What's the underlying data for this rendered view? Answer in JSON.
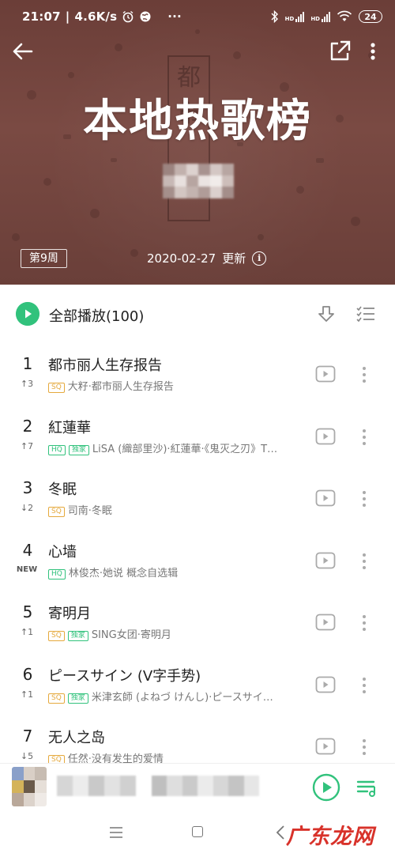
{
  "status_bar": {
    "time": "21:07",
    "speed": "4.6K/s",
    "more": "···",
    "signal_label_1": "HD",
    "signal_label_2": "HD",
    "battery": "24"
  },
  "header": {
    "title": "本地热歌榜",
    "seal_text": "都市",
    "week_badge": "第9周",
    "update_date": "2020-02-27",
    "update_label": "更新",
    "info_glyph": "i",
    "background_color": "#6f433d"
  },
  "list_header": {
    "play_all": "全部播放(100)",
    "accent_color": "#31c27c"
  },
  "songs": [
    {
      "rank": "1",
      "trend": "↑3",
      "title": "都市丽人生存报告",
      "tags": [
        "SQ"
      ],
      "meta": "大籽·都市丽人生存报告"
    },
    {
      "rank": "2",
      "trend": "↑7",
      "title": "紅蓮華",
      "tags": [
        "HQ",
        "独家"
      ],
      "meta": "LiSA (織部里沙)·紅蓮華·《鬼灭之刃》T…"
    },
    {
      "rank": "3",
      "trend": "↓2",
      "title": "冬眠",
      "tags": [
        "SQ"
      ],
      "meta": "司南·冬眠"
    },
    {
      "rank": "4",
      "trend": "NEW",
      "title": "心墙",
      "tags": [
        "HQ"
      ],
      "meta": "林俊杰·她说 概念自选辑"
    },
    {
      "rank": "5",
      "trend": "↑1",
      "title": "寄明月",
      "tags": [
        "SQ",
        "独家"
      ],
      "meta": "SING女团·寄明月"
    },
    {
      "rank": "6",
      "trend": "↑1",
      "title": "ピースサイン (V字手势)",
      "tags": [
        "SQ",
        "独家"
      ],
      "meta": "米津玄師 (よねづ けんし)·ピースサイ…"
    },
    {
      "rank": "7",
      "trend": "↓5",
      "title": "无人之岛",
      "tags": [
        "SQ"
      ],
      "meta": "任然·没有发生的爱情"
    }
  ],
  "watermark": "广东龙网",
  "icons": {
    "back": "back-arrow-icon",
    "share": "share-icon",
    "more": "more-vertical-icon",
    "play_all": "play-circle-icon",
    "download": "download-icon",
    "multi_select": "multi-select-icon",
    "mv": "mv-play-icon",
    "song_more": "more-vertical-icon",
    "play": "play-icon",
    "queue": "playlist-icon"
  }
}
